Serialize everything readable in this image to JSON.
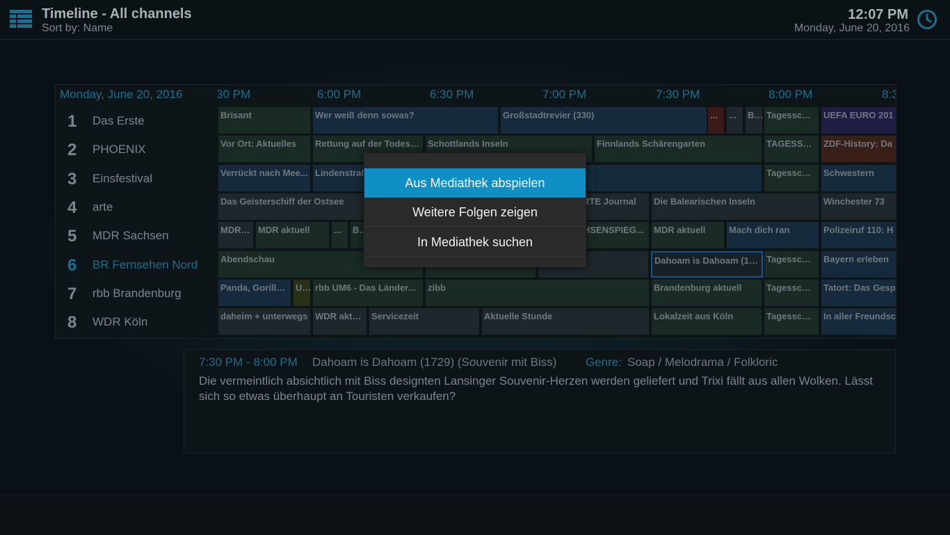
{
  "header": {
    "title": "Timeline - All channels",
    "subtitle": "Sort by: Name",
    "time": "12:07 PM",
    "date": "Monday, June 20, 2016",
    "menu_icon": "grid-list-icon",
    "clock_icon": "clock-icon"
  },
  "epg": {
    "date": "Monday, June 20, 2016",
    "times": [
      "30 PM",
      "6:00 PM",
      "6:30 PM",
      "7:00 PM",
      "7:30 PM",
      "8:00 PM",
      "8:3"
    ],
    "channels": [
      {
        "num": "1",
        "name": "Das Erste"
      },
      {
        "num": "2",
        "name": "PHOENIX"
      },
      {
        "num": "3",
        "name": "Einsfestival"
      },
      {
        "num": "4",
        "name": "arte"
      },
      {
        "num": "5",
        "name": "MDR Sachsen"
      },
      {
        "num": "6",
        "name": "BR Fernsehen Nord"
      },
      {
        "num": "7",
        "name": "rbb Brandenburg"
      },
      {
        "num": "8",
        "name": "WDR Köln"
      }
    ],
    "rows": [
      [
        "Brisant",
        "Wer weiß denn sowas?",
        "Großstadtrevier (330)",
        "...",
        "...",
        "B...",
        "Tagesschau",
        "UEFA EURO 201"
      ],
      [
        "Vor Ort: Aktuelles",
        "Rettung auf der Todesr...",
        "Schottlands Inseln",
        "Finnlands Schärengarten",
        "TAGESSC...",
        "ZDF-History: Da"
      ],
      [
        "Verrückt nach Mee...",
        "Lindenstraß",
        "",
        "Tagesschau",
        "Schwestern"
      ],
      [
        "Das Geisterschiff der Ostsee",
        "RTE Journal",
        "Die Balearischen Inseln",
        "Winchester 73"
      ],
      [
        "MDR ...",
        "MDR aktuell",
        "...",
        "Bri",
        "HSENSPIEG...",
        "MDR aktuell",
        "Mach dich ran",
        "Polizeiruf 110: H"
      ],
      [
        "Abendschau",
        "",
        "",
        "Dahoam is Dahoam (17...",
        "Tagesschau",
        "Bayern erleben"
      ],
      [
        "Panda, Gorilla ...",
        "U...",
        "rbb UM6 - Das Länder...",
        "zibb",
        "Brandenburg aktuell",
        "Tagesschau",
        "Tatort: Das Gesp"
      ],
      [
        "daheim + unterwegs",
        "WDR aktu...",
        "Servicezeit",
        "Aktuelle Stunde",
        "Lokalzeit aus Köln",
        "Tagesschau",
        "In aller Freundsch"
      ]
    ]
  },
  "info": {
    "time": "7:30 PM - 8:00 PM",
    "title": "Dahoam is Dahoam (1729) (Souvenir mit Biss)",
    "genre_label": "Genre:",
    "genre": "Soap / Melodrama / Folkloric",
    "description": "Die vermeintlich absichtlich mit Biss designten Lansinger Souvenir-Herzen werden geliefert und Trixi fällt aus allen Wolken. Lässt sich so etwas überhaupt an Touristen verkaufen?"
  },
  "dialog": {
    "items": [
      "Aus Mediathek abspielen",
      "Weitere Folgen zeigen",
      "In Mediathek suchen"
    ],
    "selected": "Aus Mediathek abspielen"
  },
  "colors": {
    "accent": "#0f8fc4",
    "label_blue": "#1e6e8f"
  }
}
